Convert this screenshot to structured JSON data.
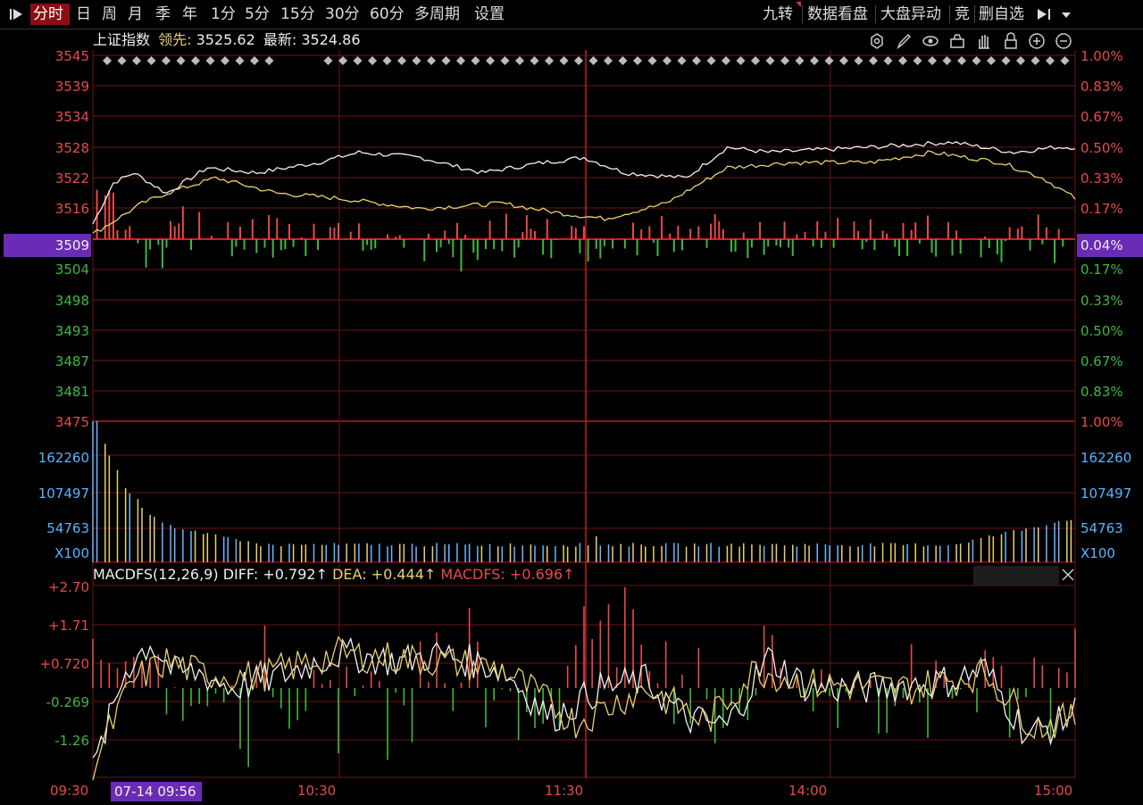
{
  "toolbar": {
    "left_icon": "collapse-left-icon",
    "tabs": [
      "分时",
      "日",
      "周",
      "月",
      "季",
      "年",
      "1分",
      "5分",
      "15分",
      "30分",
      "60分",
      "多周期",
      "设置"
    ],
    "active_tab": "分时",
    "right_buttons": [
      "九转",
      "数据看盘",
      "大盘异动",
      "竞",
      "删自选"
    ],
    "right_icon": "collapse-right-icon",
    "dropdown_icon": "dropdown-icon"
  },
  "info": {
    "name": "上证指数",
    "lead_label": "领先:",
    "lead_value": "3525.62",
    "latest_label": "最新:",
    "latest_value": "3524.86"
  },
  "tool_icons": [
    "settings-icon",
    "draw-icon",
    "eye-icon",
    "basket-icon",
    "hand-icon",
    "lock-icon",
    "zoom-in-icon",
    "zoom-out-icon"
  ],
  "price_axis": {
    "left_up": [
      "3545",
      "3539",
      "3534",
      "3528",
      "3522",
      "3516"
    ],
    "left_mid": "3509",
    "left_down": [
      "3504",
      "3498",
      "3493",
      "3487",
      "3481",
      "3475"
    ],
    "right_up": [
      "1.00%",
      "0.83%",
      "0.67%",
      "0.50%",
      "0.33%",
      "0.17%"
    ],
    "right_mid": "0.04%",
    "right_down": [
      "0.17%",
      "0.33%",
      "0.50%",
      "0.67%",
      "0.83%",
      "1.00%"
    ]
  },
  "volume_axis": {
    "labels": [
      "162260",
      "107497",
      "54763"
    ],
    "unit": "X100"
  },
  "macd": {
    "title": "MACDFS(12,26,9)",
    "diff_label": "DIFF:",
    "diff_value": "+0.792↑",
    "dea_label": "DEA:",
    "dea_value": "+0.444↑",
    "macdfs_label": "MACDFS:",
    "macdfs_value": "+0.696↑",
    "axis": [
      "+2.70",
      "+1.71",
      "+0.720",
      "-0.269",
      "-1.26"
    ],
    "close_icon": "close-icon"
  },
  "time_axis": {
    "labels": [
      "09:30",
      "10:30",
      "11:30",
      "14:00",
      "15:00"
    ],
    "cursor_label": "07-14 09:56"
  },
  "colors": {
    "up": "#e84a4a",
    "down": "#3fb83f",
    "grid": "#6e1414",
    "white_line": "#f0f0f0",
    "yellow_line": "#e8d070",
    "volume_label": "#5ab4ff",
    "highlight": "#6a2bb6"
  },
  "chart_data": [
    {
      "type": "line",
      "title": "",
      "ylim": [
        3475,
        3545
      ],
      "x": [
        "09:30",
        "10:30",
        "11:30",
        "14:00",
        "15:00"
      ],
      "series": [
        {
          "name": "",
          "values": [
            3509,
            3527,
            3526,
            3527,
            3525
          ]
        },
        {
          "name": "",
          "values": [
            3509,
            3521,
            3520,
            3526,
            3523
          ]
        }
      ]
    },
    {
      "type": "bar",
      "title": "",
      "ylabel": "X100",
      "categories": [
        "09:30",
        "10:30",
        "11:30",
        "14:00",
        "15:00"
      ],
      "values": [
        210000,
        32000,
        26000,
        28000,
        70000
      ]
    },
    {
      "type": "line",
      "title": "MACDFS(12,26,9)",
      "ylim": [
        -2.2,
        3.0
      ],
      "x": [
        "09:30",
        "10:30",
        "11:30",
        "14:00",
        "15:00"
      ],
      "series": [
        {
          "name": "DIFF",
          "values": [
            -2.0,
            0.9,
            0.0,
            0.1,
            0.792
          ]
        },
        {
          "name": "DEA",
          "values": [
            -1.8,
            0.9,
            -0.1,
            0.1,
            0.444
          ]
        }
      ]
    }
  ]
}
